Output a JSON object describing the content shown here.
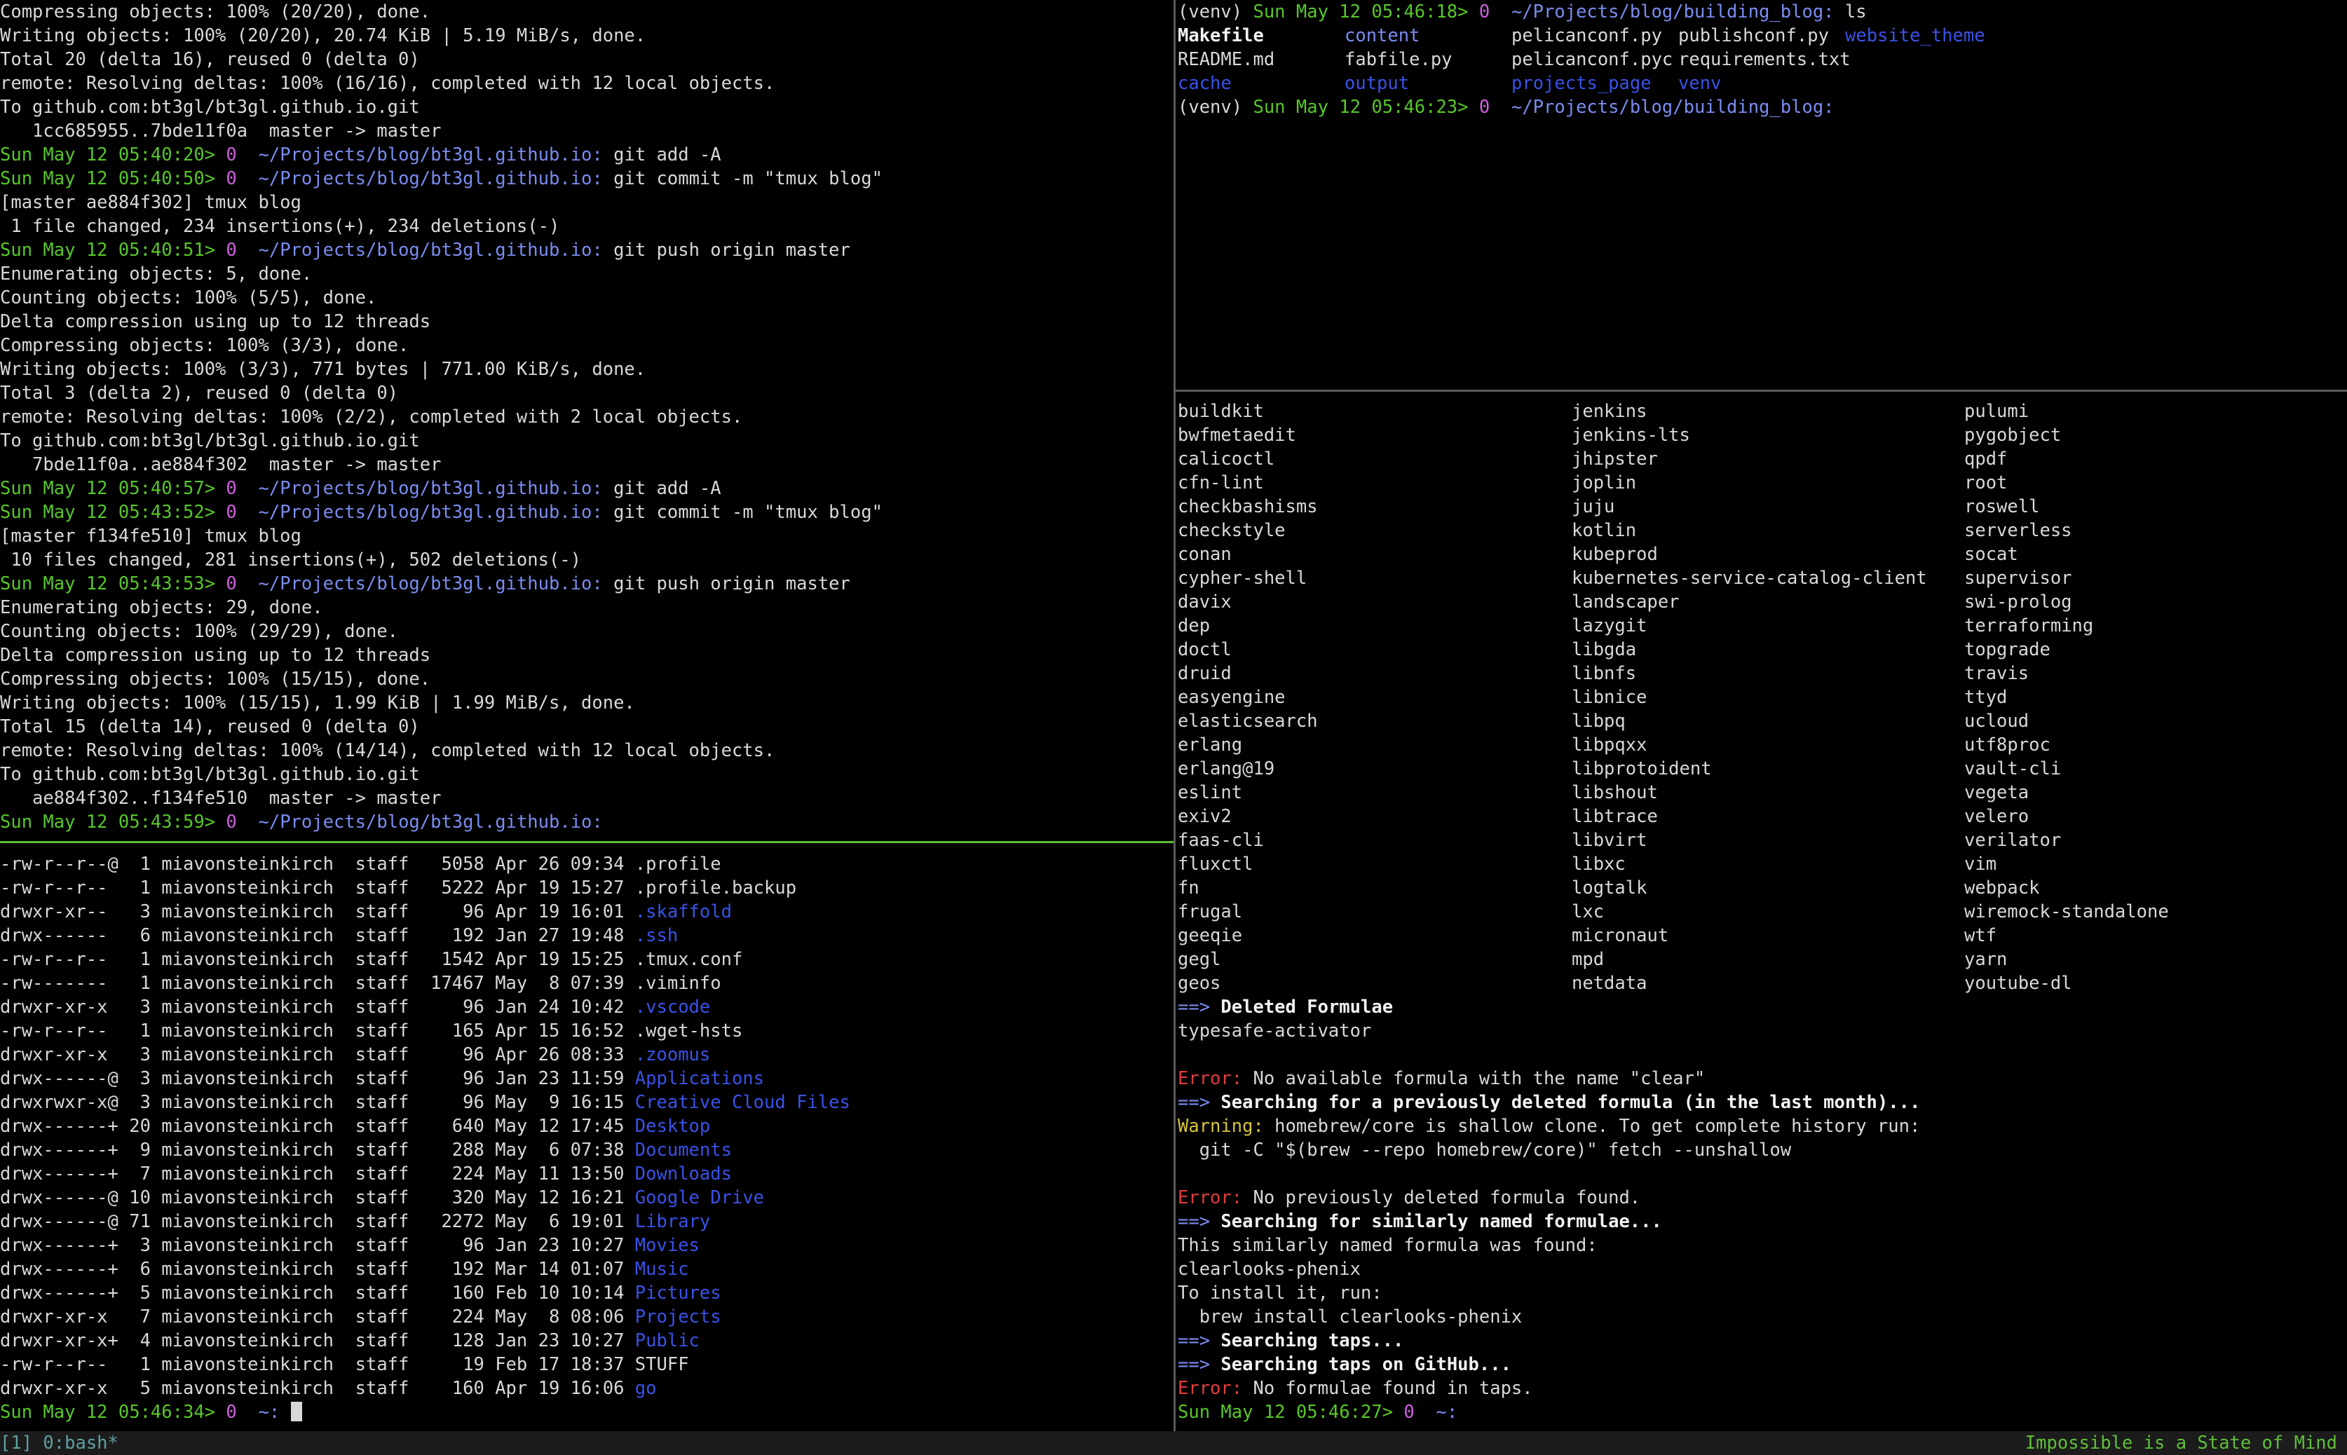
{
  "top_left": {
    "lines": [
      [
        [
          "",
          "Compressing objects: 100% (20/20), done."
        ]
      ],
      [
        [
          "",
          "Writing objects: 100% (20/20), 20.74 KiB | 5.19 MiB/s, done."
        ]
      ],
      [
        [
          "",
          "Total 20 (delta 16), reused 0 (delta 0)"
        ]
      ],
      [
        [
          "",
          "remote: Resolving deltas: 100% (16/16), completed with 12 local objects."
        ]
      ],
      [
        [
          "",
          "To github.com:bt3gl/bt3gl.github.io.git"
        ]
      ],
      [
        [
          "",
          "   1cc685955..7bde11f0a  master -> master"
        ]
      ],
      [
        [
          "g",
          "Sun May 12 05:40:20>"
        ],
        [
          "",
          " "
        ],
        [
          "pk",
          "0"
        ],
        [
          "",
          "  "
        ],
        [
          "cy",
          "~/Projects/blog/bt3gl.github.io:"
        ],
        [
          "",
          " git add -A"
        ]
      ],
      [
        [
          "g",
          "Sun May 12 05:40:50>"
        ],
        [
          "",
          " "
        ],
        [
          "pk",
          "0"
        ],
        [
          "",
          "  "
        ],
        [
          "cy",
          "~/Projects/blog/bt3gl.github.io:"
        ],
        [
          "",
          " git commit -m \"tmux blog\""
        ]
      ],
      [
        [
          "",
          "[master ae884f302] tmux blog"
        ]
      ],
      [
        [
          "",
          " 1 file changed, 234 insertions(+), 234 deletions(-)"
        ]
      ],
      [
        [
          "g",
          "Sun May 12 05:40:51>"
        ],
        [
          "",
          " "
        ],
        [
          "pk",
          "0"
        ],
        [
          "",
          "  "
        ],
        [
          "cy",
          "~/Projects/blog/bt3gl.github.io:"
        ],
        [
          "",
          " git push origin master"
        ]
      ],
      [
        [
          "",
          "Enumerating objects: 5, done."
        ]
      ],
      [
        [
          "",
          "Counting objects: 100% (5/5), done."
        ]
      ],
      [
        [
          "",
          "Delta compression using up to 12 threads"
        ]
      ],
      [
        [
          "",
          "Compressing objects: 100% (3/3), done."
        ]
      ],
      [
        [
          "",
          "Writing objects: 100% (3/3), 771 bytes | 771.00 KiB/s, done."
        ]
      ],
      [
        [
          "",
          "Total 3 (delta 2), reused 0 (delta 0)"
        ]
      ],
      [
        [
          "",
          "remote: Resolving deltas: 100% (2/2), completed with 2 local objects."
        ]
      ],
      [
        [
          "",
          "To github.com:bt3gl/bt3gl.github.io.git"
        ]
      ],
      [
        [
          "",
          "   7bde11f0a..ae884f302  master -> master"
        ]
      ],
      [
        [
          "g",
          "Sun May 12 05:40:57>"
        ],
        [
          "",
          " "
        ],
        [
          "pk",
          "0"
        ],
        [
          "",
          "  "
        ],
        [
          "cy",
          "~/Projects/blog/bt3gl.github.io:"
        ],
        [
          "",
          " git add -A"
        ]
      ],
      [
        [
          "g",
          "Sun May 12 05:43:52>"
        ],
        [
          "",
          " "
        ],
        [
          "pk",
          "0"
        ],
        [
          "",
          "  "
        ],
        [
          "cy",
          "~/Projects/blog/bt3gl.github.io:"
        ],
        [
          "",
          " git commit -m \"tmux blog\""
        ]
      ],
      [
        [
          "",
          "[master f134fe510] tmux blog"
        ]
      ],
      [
        [
          "",
          " 10 files changed, 281 insertions(+), 502 deletions(-)"
        ]
      ],
      [
        [
          "g",
          "Sun May 12 05:43:53>"
        ],
        [
          "",
          " "
        ],
        [
          "pk",
          "0"
        ],
        [
          "",
          "  "
        ],
        [
          "cy",
          "~/Projects/blog/bt3gl.github.io:"
        ],
        [
          "",
          " git push origin master"
        ]
      ],
      [
        [
          "",
          "Enumerating objects: 29, done."
        ]
      ],
      [
        [
          "",
          "Counting objects: 100% (29/29), done."
        ]
      ],
      [
        [
          "",
          "Delta compression using up to 12 threads"
        ]
      ],
      [
        [
          "",
          "Compressing objects: 100% (15/15), done."
        ]
      ],
      [
        [
          "",
          "Writing objects: 100% (15/15), 1.99 KiB | 1.99 MiB/s, done."
        ]
      ],
      [
        [
          "",
          "Total 15 (delta 14), reused 0 (delta 0)"
        ]
      ],
      [
        [
          "",
          "remote: Resolving deltas: 100% (14/14), completed with 12 local objects."
        ]
      ],
      [
        [
          "",
          "To github.com:bt3gl/bt3gl.github.io.git"
        ]
      ],
      [
        [
          "",
          "   ae884f302..f134fe510  master -> master"
        ]
      ],
      [
        [
          "g",
          "Sun May 12 05:43:59>"
        ],
        [
          "",
          " "
        ],
        [
          "pk",
          "0"
        ],
        [
          "",
          "  "
        ],
        [
          "cy",
          "~/Projects/blog/bt3gl.github.io:"
        ]
      ]
    ]
  },
  "bottom_left": {
    "lines": [
      [
        [
          "",
          "-rw-r--r--@  1 miavonsteinkirch  staff   5058 Apr 26 09:34 "
        ],
        [
          "",
          ".profile"
        ]
      ],
      [
        [
          "",
          "-rw-r--r--   1 miavonsteinkirch  staff   5222 Apr 19 15:27 "
        ],
        [
          "",
          ".profile.backup"
        ]
      ],
      [
        [
          "",
          "drwxr-xr--   3 miavonsteinkirch  staff     96 Apr 19 16:01 "
        ],
        [
          "bl",
          ".skaffold"
        ]
      ],
      [
        [
          "",
          "drwx------   6 miavonsteinkirch  staff    192 Jan 27 19:48 "
        ],
        [
          "bl",
          ".ssh"
        ]
      ],
      [
        [
          "",
          "-rw-r--r--   1 miavonsteinkirch  staff   1542 Apr 19 15:25 "
        ],
        [
          "",
          ".tmux.conf"
        ]
      ],
      [
        [
          "",
          "-rw-------   1 miavonsteinkirch  staff  17467 May  8 07:39 "
        ],
        [
          "",
          ".viminfo"
        ]
      ],
      [
        [
          "",
          "drwxr-xr-x   3 miavonsteinkirch  staff     96 Jan 24 10:42 "
        ],
        [
          "bl",
          ".vscode"
        ]
      ],
      [
        [
          "",
          "-rw-r--r--   1 miavonsteinkirch  staff    165 Apr 15 16:52 "
        ],
        [
          "",
          ".wget-hsts"
        ]
      ],
      [
        [
          "",
          "drwxr-xr-x   3 miavonsteinkirch  staff     96 Apr 26 08:33 "
        ],
        [
          "bl",
          ".zoomus"
        ]
      ],
      [
        [
          "",
          "drwx------@  3 miavonsteinkirch  staff     96 Jan 23 11:59 "
        ],
        [
          "bl",
          "Applications"
        ]
      ],
      [
        [
          "",
          "drwxrwxr-x@  3 miavonsteinkirch  staff     96 May  9 16:15 "
        ],
        [
          "bl",
          "Creative Cloud Files"
        ]
      ],
      [
        [
          "",
          "drwx------+ 20 miavonsteinkirch  staff    640 May 12 17:45 "
        ],
        [
          "bl",
          "Desktop"
        ]
      ],
      [
        [
          "",
          "drwx------+  9 miavonsteinkirch  staff    288 May  6 07:38 "
        ],
        [
          "bl",
          "Documents"
        ]
      ],
      [
        [
          "",
          "drwx------+  7 miavonsteinkirch  staff    224 May 11 13:50 "
        ],
        [
          "bl",
          "Downloads"
        ]
      ],
      [
        [
          "",
          "drwx------@ 10 miavonsteinkirch  staff    320 May 12 16:21 "
        ],
        [
          "bl",
          "Google Drive"
        ]
      ],
      [
        [
          "",
          "drwx------@ 71 miavonsteinkirch  staff   2272 May  6 19:01 "
        ],
        [
          "bl",
          "Library"
        ]
      ],
      [
        [
          "",
          "drwx------+  3 miavonsteinkirch  staff     96 Jan 23 10:27 "
        ],
        [
          "bl",
          "Movies"
        ]
      ],
      [
        [
          "",
          "drwx------+  6 miavonsteinkirch  staff    192 Mar 14 01:07 "
        ],
        [
          "bl",
          "Music"
        ]
      ],
      [
        [
          "",
          "drwx------+  5 miavonsteinkirch  staff    160 Feb 10 10:14 "
        ],
        [
          "bl",
          "Pictures"
        ]
      ],
      [
        [
          "",
          "drwxr-xr-x   7 miavonsteinkirch  staff    224 May  8 08:06 "
        ],
        [
          "bl",
          "Projects"
        ]
      ],
      [
        [
          "",
          "drwxr-xr-x+  4 miavonsteinkirch  staff    128 Jan 23 10:27 "
        ],
        [
          "bl",
          "Public"
        ]
      ],
      [
        [
          "",
          "-rw-r--r--   1 miavonsteinkirch  staff     19 Feb 17 18:37 "
        ],
        [
          "",
          "STUFF"
        ]
      ],
      [
        [
          "",
          "drwxr-xr-x   5 miavonsteinkirch  staff    160 Apr 19 16:06 "
        ],
        [
          "bl",
          "go"
        ]
      ]
    ],
    "prompt": [
      [
        "g",
        "Sun May 12 05:46:34>"
      ],
      [
        "",
        " "
      ],
      [
        "pk",
        "0"
      ],
      [
        "",
        "  "
      ],
      [
        "cy",
        "~:"
      ],
      [
        "",
        " "
      ]
    ]
  },
  "top_right": {
    "prompt1": [
      [
        "",
        "(venv) "
      ],
      [
        "g",
        "Sun May 12 05:46:18>"
      ],
      [
        "",
        " "
      ],
      [
        "pk",
        "0"
      ],
      [
        "",
        "  "
      ],
      [
        "cy",
        "~/Projects/blog/building_blog:"
      ],
      [
        "",
        " ls"
      ]
    ],
    "ls_items": [
      [
        "wb",
        "Makefile"
      ],
      [
        "cy",
        "content"
      ],
      [
        "",
        "pelicanconf.py"
      ],
      [
        "",
        "publishconf.py"
      ],
      [
        "bl",
        "website_theme"
      ],
      [
        "",
        "README.md"
      ],
      [
        "",
        "fabfile.py"
      ],
      [
        "",
        "pelicanconf.pyc"
      ],
      [
        "",
        "requirements.txt"
      ],
      [
        "",
        ""
      ],
      [
        "bl",
        "cache"
      ],
      [
        "bl",
        "output"
      ],
      [
        "bl",
        "projects_page"
      ],
      [
        "bl",
        "venv"
      ],
      [
        "",
        ""
      ]
    ],
    "prompt2": [
      [
        "",
        "(venv) "
      ],
      [
        "g",
        "Sun May 12 05:46:23>"
      ],
      [
        "",
        " "
      ],
      [
        "pk",
        "0"
      ],
      [
        "",
        "  "
      ],
      [
        "cy",
        "~/Projects/blog/building_blog:"
      ]
    ]
  },
  "bottom_right": {
    "col1": [
      "buildkit",
      "bwfmetaedit",
      "calicoctl",
      "cfn-lint",
      "checkbashisms",
      "checkstyle",
      "conan",
      "cypher-shell",
      "davix",
      "dep",
      "doctl",
      "druid",
      "easyengine",
      "elasticsearch",
      "erlang",
      "erlang@19",
      "eslint",
      "exiv2",
      "faas-cli",
      "fluxctl",
      "fn",
      "frugal",
      "geeqie",
      "gegl",
      "geos"
    ],
    "col2": [
      "jenkins",
      "jenkins-lts",
      "jhipster",
      "joplin",
      "juju",
      "kotlin",
      "kubeprod",
      "kubernetes-service-catalog-client",
      "landscaper",
      "lazygit",
      "libgda",
      "libnfs",
      "libnice",
      "libpq",
      "libpqxx",
      "libprotoident",
      "libshout",
      "libtrace",
      "libvirt",
      "libxc",
      "logtalk",
      "lxc",
      "micronaut",
      "mpd",
      "netdata"
    ],
    "col3": [
      "pulumi",
      "pygobject",
      "qpdf",
      "root",
      "roswell",
      "serverless",
      "socat",
      "supervisor",
      "swi-prolog",
      "terraforming",
      "topgrade",
      "travis",
      "ttyd",
      "ucloud",
      "utf8proc",
      "vault-cli",
      "vegeta",
      "velero",
      "verilator",
      "vim",
      "webpack",
      "wiremock-standalone",
      "wtf",
      "yarn",
      "youtube-dl"
    ],
    "lines": [
      [
        [
          "cy",
          "==>"
        ],
        [
          "wb",
          " Deleted Formulae"
        ]
      ],
      [
        [
          "",
          "typesafe-activator"
        ]
      ],
      [
        [
          "",
          ""
        ]
      ],
      [
        [
          "rd",
          "Error:"
        ],
        [
          "",
          " No available formula with the name \"clear\""
        ]
      ],
      [
        [
          "cy",
          "==>"
        ],
        [
          "wb",
          " Searching for a previously deleted formula (in the last month)..."
        ]
      ],
      [
        [
          "ye",
          "Warning:"
        ],
        [
          "",
          " homebrew/core is shallow clone. To get complete history run:"
        ]
      ],
      [
        [
          "",
          "  git -C \"$(brew --repo homebrew/core)\" fetch --unshallow"
        ]
      ],
      [
        [
          "",
          ""
        ]
      ],
      [
        [
          "rd",
          "Error:"
        ],
        [
          "",
          " No previously deleted formula found."
        ]
      ],
      [
        [
          "cy",
          "==>"
        ],
        [
          "wb",
          " Searching for similarly named formulae..."
        ]
      ],
      [
        [
          "",
          "This similarly named formula was found:"
        ]
      ],
      [
        [
          "",
          "clearlooks-phenix"
        ]
      ],
      [
        [
          "",
          "To install it, run:"
        ]
      ],
      [
        [
          "",
          "  brew install clearlooks-phenix"
        ]
      ],
      [
        [
          "cy",
          "==>"
        ],
        [
          "wb",
          " Searching taps..."
        ]
      ],
      [
        [
          "cy",
          "==>"
        ],
        [
          "wb",
          " Searching taps on GitHub..."
        ]
      ],
      [
        [
          "rd",
          "Error:"
        ],
        [
          "",
          " No formulae found in taps."
        ]
      ],
      [
        [
          "g",
          "Sun May 12 05:46:27>"
        ],
        [
          "",
          " "
        ],
        [
          "pk",
          "0"
        ],
        [
          "",
          "  "
        ],
        [
          "cy",
          "~:"
        ]
      ]
    ]
  },
  "status_bar": {
    "left": "[1] 0:bash*",
    "right": "Impossible is a State of Mind"
  },
  "colors": {
    "prompt_time": "#57c728",
    "exit_code": "#d060e0",
    "path": "#7b8cf0",
    "directory": "#3a52e8",
    "error": "#e03d3d",
    "warning": "#d8c23a",
    "active_pane_border": "#5fbf3a"
  }
}
